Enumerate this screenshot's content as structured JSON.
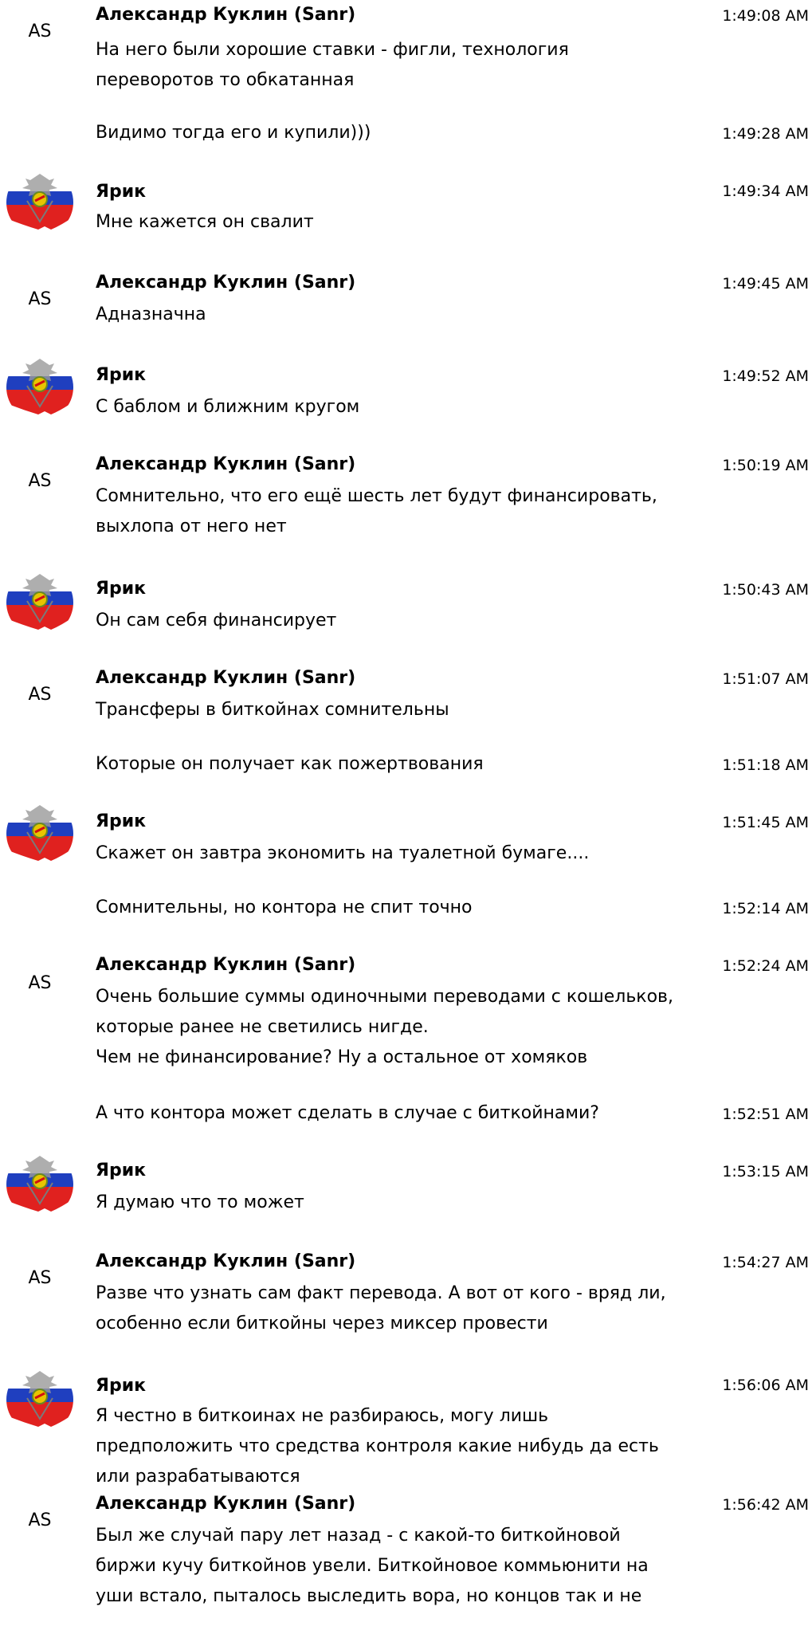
{
  "users": {
    "sanr": {
      "name": "Александр Куклин (Sanr)",
      "initials": "AS"
    },
    "yarik": {
      "name": "Ярик"
    }
  },
  "messages": [
    {
      "time": "1:49:08 AM",
      "text": "На него были хорошие ставки - фигли, технология\nпереворотов то обкатанная"
    },
    {
      "time": "1:49:28 AM",
      "text": "Видимо тогда его и купили)))"
    },
    {
      "time": "1:49:34 AM",
      "text": "Мне кажется он свалит"
    },
    {
      "time": "1:49:45 AM",
      "text": "Адназначна"
    },
    {
      "time": "1:49:52 AM",
      "text": "С баблом и ближним кругом"
    },
    {
      "time": "1:50:19 AM",
      "text": "Сомнительно, что его ещё шесть лет будут финансировать,\nвыхлопа от него нет"
    },
    {
      "time": "1:50:43 AM",
      "text": "Он сам себя финансирует"
    },
    {
      "time": "1:51:07 AM",
      "text": "Трансферы в биткойнах сомнительны"
    },
    {
      "time": "1:51:18 AM",
      "text": "Которые он получает как пожертвования"
    },
    {
      "time": "1:51:45 AM",
      "text": "Скажет он завтра экономить на туалетной бумаге...."
    },
    {
      "time": "1:52:14 AM",
      "text": "Сомнительны, но контора не спит точно"
    },
    {
      "time": "1:52:24 AM",
      "text": "Очень большие суммы одиночными переводами с кошельков,\nкоторые ранее не светились нигде.\nЧем не финансирование? Ну а остальное от хомяков"
    },
    {
      "time": "1:52:51 AM",
      "text": "А что контора может сделать в случае с биткойнами?"
    },
    {
      "time": "1:53:15 AM",
      "text": "Я думаю что то может"
    },
    {
      "time": "1:54:27 AM",
      "text": "Разве что узнать сам факт перевода. А вот от кого - вряд ли,\nособенно если биткойны через миксер провести"
    },
    {
      "time": "1:56:06 AM",
      "text": "Я честно в биткоинах не разбираюсь, могу лишь\nпредположить что средства контроля какие нибудь да есть\nили разрабатываются"
    },
    {
      "time": "1:56:42 AM",
      "text": "Был же случай пару лет назад - с какой-то биткойновой\nбиржи кучу биткойнов увели. Биткойновое коммьюнити на\nуши встало, пыталось выследить вора, но концов так и не"
    }
  ],
  "avatar": {
    "icon": "emblem-flag-avatar-icon",
    "flag_colors": [
      "#ffffff",
      "#1f3fbf",
      "#e0211f"
    ]
  }
}
